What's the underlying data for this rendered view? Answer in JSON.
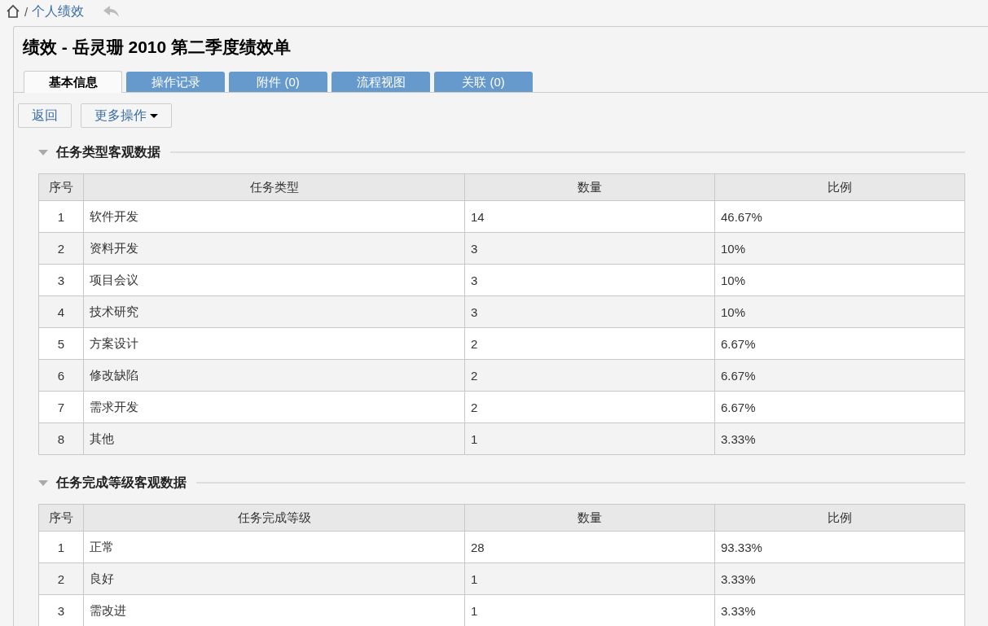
{
  "breadcrumb": {
    "separator": "/",
    "current": "个人绩效"
  },
  "title": "绩效 - 岳灵珊 2010 第二季度绩效单",
  "tabs": [
    {
      "label": "基本信息",
      "selected": true
    },
    {
      "label": "操作记录",
      "selected": false
    },
    {
      "label": "附件 (0)",
      "selected": false
    },
    {
      "label": "流程视图",
      "selected": false
    },
    {
      "label": "关联 (0)",
      "selected": false
    }
  ],
  "buttons": [
    {
      "label": "返回",
      "kind": "plain"
    },
    {
      "label": "更多操作",
      "kind": "dropdown"
    }
  ],
  "sections": [
    {
      "title": "任务类型客观数据",
      "expanded": true,
      "table": {
        "columns": [
          "序号",
          "任务类型",
          "数量",
          "比例"
        ],
        "rows": [
          [
            "1",
            "软件开发",
            "14",
            "46.67%"
          ],
          [
            "2",
            "资料开发",
            "3",
            "10%"
          ],
          [
            "3",
            "项目会议",
            "3",
            "10%"
          ],
          [
            "4",
            "技术研究",
            "3",
            "10%"
          ],
          [
            "5",
            "方案设计",
            "2",
            "6.67%"
          ],
          [
            "6",
            "修改缺陷",
            "2",
            "6.67%"
          ],
          [
            "7",
            "需求开发",
            "2",
            "6.67%"
          ],
          [
            "8",
            "其他",
            "1",
            "3.33%"
          ]
        ]
      }
    },
    {
      "title": "任务完成等级客观数据",
      "expanded": true,
      "table": {
        "columns": [
          "序号",
          "任务完成等级",
          "数量",
          "比例"
        ],
        "rows": [
          [
            "1",
            "正常",
            "28",
            "93.33%"
          ],
          [
            "2",
            "良好",
            "1",
            "3.33%"
          ],
          [
            "3",
            "需改进",
            "1",
            "3.33%"
          ]
        ]
      }
    }
  ]
}
